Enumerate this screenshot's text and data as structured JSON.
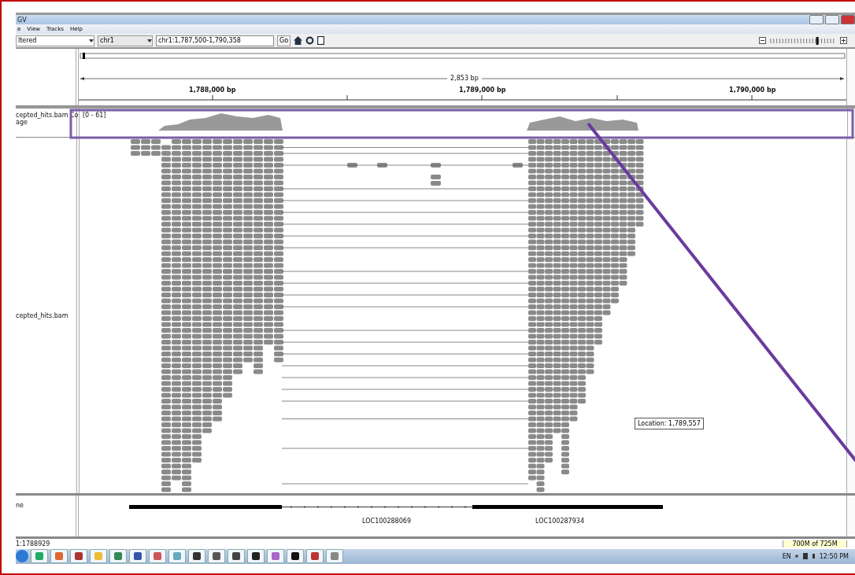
{
  "window": {
    "title": "GV"
  },
  "menu": [
    "e",
    "View",
    "Tracks",
    "Help"
  ],
  "toolbar": {
    "genome": "ltered",
    "chromosome": "chr1",
    "locus": "chr1:1,787,500-1,790,358",
    "go": "Go",
    "zoom": {
      "level": 0.72
    }
  },
  "ruler": {
    "span": "2,853 bp",
    "ticks": [
      "1,788,000 bp",
      "1,789,000 bp",
      "1,790,000 bp"
    ]
  },
  "tracks": [
    {
      "kind": "coverage",
      "name": "cepted_hits.bam Co",
      "name_2": "age",
      "range": "[0 - 61]"
    },
    {
      "kind": "alignments",
      "name": "cepted_hits.bam",
      "tooltip": "Location: 1,789,557"
    },
    {
      "kind": "gene",
      "name": "ne",
      "labels": [
        "LOC100288069",
        "LOC100287934"
      ]
    }
  ],
  "status_bar": {
    "position": "1:1788929",
    "memory": "700M of 725M"
  },
  "taskbar": {
    "language": "EN",
    "time": "12:50 PM"
  }
}
